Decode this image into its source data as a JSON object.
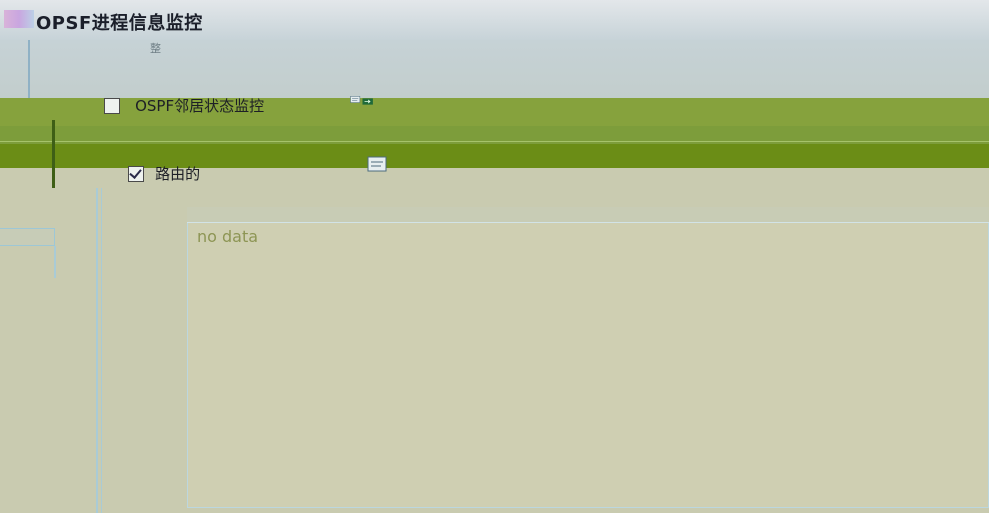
{
  "window": {
    "title": "OPSF进程信息监控",
    "sub_caption": "整"
  },
  "sections": {
    "ospf_status": {
      "label": "OSPF邻居状态监控",
      "checked": false
    },
    "route": {
      "label": "路由的",
      "checked": true
    }
  },
  "data_panel": {
    "empty_text": "no data"
  },
  "colors": {
    "band_green": "#86a23d",
    "band_dark": "#6b8d16",
    "panel_bg": "#cfcfb2"
  }
}
